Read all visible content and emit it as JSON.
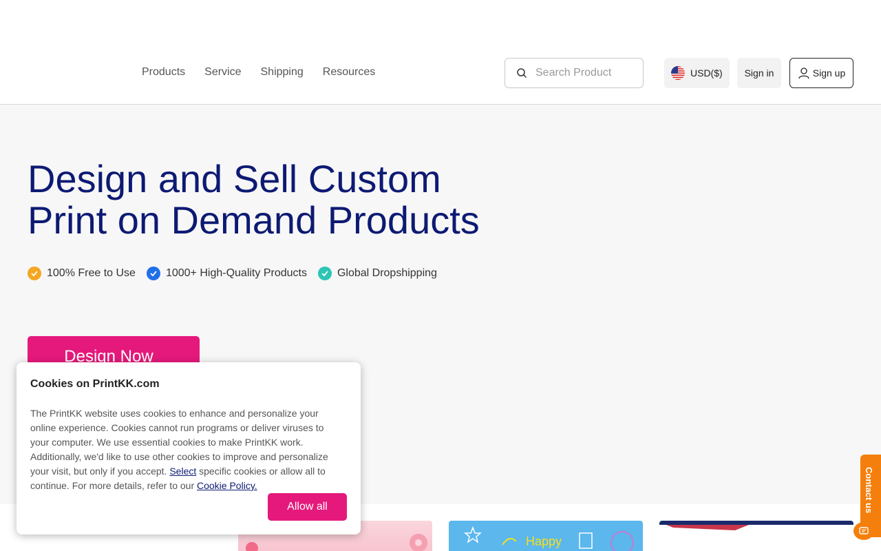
{
  "nav": {
    "items": [
      {
        "label": "Products"
      },
      {
        "label": "Service"
      },
      {
        "label": "Shipping"
      },
      {
        "label": "Resources"
      }
    ]
  },
  "search": {
    "placeholder": "Search Product",
    "icon": "search-icon"
  },
  "currency": {
    "label": "USD($)",
    "icon": "us-flag-icon"
  },
  "auth": {
    "signin_label": "Sign in",
    "signup_label": "Sign up",
    "signup_icon": "user-icon"
  },
  "hero": {
    "title_line1": "Design and Sell Custom",
    "title_line2": "Print on Demand Products",
    "features": [
      {
        "label": "100% Free to Use",
        "color": "#f5a623"
      },
      {
        "label": "1000+ High-Quality Products",
        "color": "#1e6fe8"
      },
      {
        "label": "Global Dropshipping",
        "color": "#2ec4b6"
      }
    ],
    "cta_label": "Design Now"
  },
  "cards": {
    "card2_text": "Happy"
  },
  "contact": {
    "label": "Contact us",
    "icon": "chat-icon"
  },
  "cookie": {
    "title": "Cookies on PrintKK.com",
    "body_before_select": "The PrintKK website uses cookies to enhance and personalize your online experience. Cookies cannot run programs or deliver viruses to your computer. We use essential cookies to make PrintKK work. Additionally, we'd like to use other cookies to improve and personalize your visit, but only if you accept. ",
    "select_link": "Select",
    "body_middle": " specific cookies or allow all to continue. For more details, refer to our ",
    "policy_link": "Cookie Policy.",
    "allow_label": "Allow all"
  },
  "colors": {
    "brand_pink": "#e5197b",
    "navy": "#0d1a73",
    "contact_orange": "#f57f0c"
  }
}
